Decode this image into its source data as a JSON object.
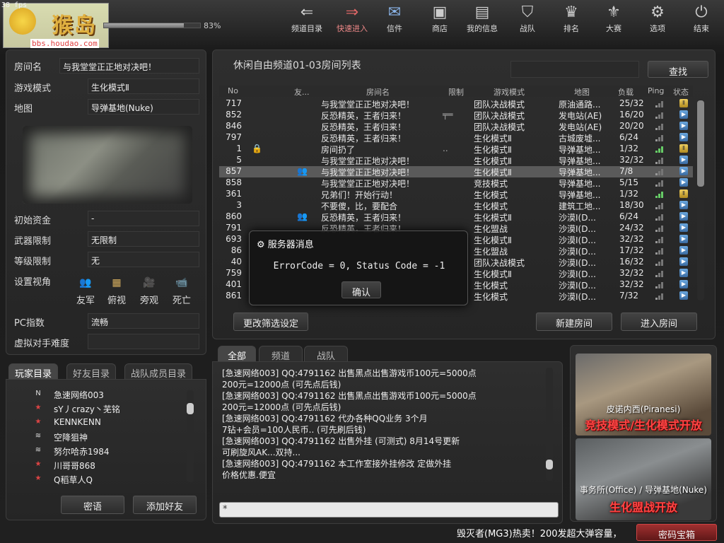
{
  "fps": "38 fps",
  "logo": {
    "text": "猴岛",
    "url": "bbs.houdao.com"
  },
  "progress": {
    "percent": 83,
    "text": "83%"
  },
  "nav": [
    {
      "label": "频道目录",
      "icon": "arrow-left-icon"
    },
    {
      "label": "快速进入",
      "icon": "double-arrow-right-icon"
    },
    {
      "label": "信件",
      "icon": "mail-icon"
    },
    {
      "label": "商店",
      "icon": "shop-icon"
    },
    {
      "label": "我的信息",
      "icon": "profile-card-icon"
    },
    {
      "label": "战队",
      "icon": "clan-shield-icon"
    },
    {
      "label": "排名",
      "icon": "trophy-icon"
    },
    {
      "label": "大赛",
      "icon": "medal-icon"
    },
    {
      "label": "选项",
      "icon": "gear-icon"
    },
    {
      "label": "结束",
      "icon": "power-icon"
    }
  ],
  "room_info": {
    "name_label": "房间名",
    "name_value": "与我堂堂正正地对决吧！",
    "mode_label": "游戏模式",
    "mode_value": "生化模式Ⅱ",
    "map_label": "地图",
    "map_value": "导弹基地(Nuke)",
    "money_label": "初始资金",
    "money_value": "-",
    "weapon_label": "武器限制",
    "weapon_value": "无限制",
    "level_label": "等级限制",
    "level_value": "无",
    "view_label": "设置视角",
    "view_options": [
      "友军",
      "俯视",
      "旁观",
      "死亡"
    ],
    "pc_label": "PC指数",
    "pc_value": "流畅",
    "ai_label": "虚拟对手难度",
    "ai_value": ""
  },
  "player_tabs": [
    "玩家目录",
    "好友目录",
    "战队成员目录"
  ],
  "players": [
    {
      "rank": "N",
      "name": "急速网络003"
    },
    {
      "rank": "★",
      "name": "sY丿crazy丶芜铭"
    },
    {
      "rank": "★",
      "name": "KENNKENN"
    },
    {
      "rank": "≋",
      "name": "空降狙神"
    },
    {
      "rank": "≋",
      "name": "努尔哈赤1984"
    },
    {
      "rank": "★",
      "name": "川哥哥868"
    },
    {
      "rank": "★",
      "name": "Q稻草人Q"
    }
  ],
  "player_buttons": {
    "whisper": "密语",
    "add_friend": "添加好友"
  },
  "room_list": {
    "title": "休闲自由频道01-03房间列表",
    "search_button": "查找",
    "headers": [
      "No",
      "友...",
      "房间名",
      "限制",
      "游戏模式",
      "地图",
      "负载",
      "Ping",
      "状态"
    ],
    "rows": [
      {
        "no": "717",
        "name": "与我堂堂正正地对决吧！",
        "limit": "",
        "mode": "团队决战模式",
        "map": "原油通路...",
        "load": "25/32",
        "ping": 1,
        "status": "wait"
      },
      {
        "no": "852",
        "name": "反恐精英，王者归来！",
        "limit": "gun",
        "mode": "团队决战模式",
        "map": "发电站(AE)",
        "load": "16/20",
        "ping": 1,
        "status": "play"
      },
      {
        "no": "846",
        "name": "反恐精英，王者归来！",
        "limit": "",
        "mode": "团队决战模式",
        "map": "发电站(AE)",
        "load": "20/20",
        "ping": 1,
        "status": "play"
      },
      {
        "no": "797",
        "name": "反恐精英，王者归来！",
        "limit": "",
        "mode": "生化模式Ⅱ",
        "map": "古城废墟...",
        "load": "6/24",
        "ping": 1,
        "status": "play"
      },
      {
        "no": "1",
        "name": "房间扔了",
        "limit": "..",
        "mode": "生化模式Ⅱ",
        "map": "导弹基地...",
        "load": "1/32",
        "ping": 3,
        "status": "wait",
        "lock": true
      },
      {
        "no": "5",
        "name": "与我堂堂正正地对决吧！",
        "limit": "",
        "mode": "生化模式Ⅱ",
        "map": "导弹基地...",
        "load": "32/32",
        "ping": 1,
        "status": "play"
      },
      {
        "no": "857",
        "name": "与我堂堂正正地对决吧！",
        "limit": "",
        "mode": "生化模式Ⅱ",
        "map": "导弹基地...",
        "load": "7/8",
        "ping": 1,
        "status": "play",
        "friend": true,
        "selected": true
      },
      {
        "no": "858",
        "name": "与我堂堂正正地对决吧！",
        "limit": "",
        "mode": "竞技模式",
        "map": "导弹基地...",
        "load": "5/15",
        "ping": 1,
        "status": "play"
      },
      {
        "no": "361",
        "name": "兄弟们！开始行动！",
        "limit": "",
        "mode": "生化模式",
        "map": "导弹基地...",
        "load": "1/32",
        "ping": 3,
        "status": "wait"
      },
      {
        "no": "3",
        "name": "不要傻，比，要配合",
        "limit": "",
        "mode": "生化模式",
        "map": "建筑工地...",
        "load": "18/30",
        "ping": 1,
        "status": "play"
      },
      {
        "no": "860",
        "name": "反恐精英，王者归来！",
        "limit": "",
        "mode": "生化模式Ⅱ",
        "map": "沙漠Ⅰ(D...",
        "load": "6/24",
        "ping": 1,
        "status": "play",
        "friend": true
      },
      {
        "no": "791",
        "name": "反恐精英，王者归来！",
        "limit": "",
        "mode": "生化盟战",
        "map": "沙漠Ⅰ(D...",
        "load": "24/32",
        "ping": 1,
        "status": "play"
      },
      {
        "no": "693",
        "name": "",
        "limit": "",
        "mode": "生化模式Ⅱ",
        "map": "沙漠Ⅰ(D...",
        "load": "32/32",
        "ping": 1,
        "status": "play"
      },
      {
        "no": "86",
        "name": "",
        "limit": "",
        "mode": "生化盟战",
        "map": "沙漠Ⅰ(D...",
        "load": "17/32",
        "ping": 1,
        "status": "play"
      },
      {
        "no": "40",
        "name": "",
        "limit": "",
        "mode": "团队决战模式",
        "map": "沙漠Ⅰ(D...",
        "load": "16/32",
        "ping": 1,
        "status": "play"
      },
      {
        "no": "759",
        "name": "",
        "limit": "",
        "mode": "生化模式Ⅱ",
        "map": "沙漠Ⅰ(D...",
        "load": "32/32",
        "ping": 1,
        "status": "play"
      },
      {
        "no": "401",
        "name": "",
        "limit": "",
        "mode": "生化模式",
        "map": "沙漠Ⅰ(D...",
        "load": "32/32",
        "ping": 1,
        "status": "play"
      },
      {
        "no": "861",
        "name": "",
        "limit": "",
        "mode": "生化模式",
        "map": "沙漠Ⅰ(D...",
        "load": "7/32",
        "ping": 1,
        "status": "play"
      }
    ],
    "buttons": {
      "filter": "更改筛选设定",
      "create": "新建房间",
      "enter": "进入房间"
    }
  },
  "dialog": {
    "title": "服务器消息",
    "message": "ErrorCode = 0, Status Code = -1",
    "ok": "确认"
  },
  "chat_tabs": [
    "全部",
    "频道",
    "战队"
  ],
  "chat_lines": [
    "[急速网络003] QQ:4791162  出售黑点出售游戏币100元=5000点",
    "200元=12000点 (可先点后钱)",
    "[急速网络003] QQ:4791162  出售黑点出售游戏币100元=5000点",
    "200元=12000点 (可先点后钱)",
    "[急速网络003] QQ:4791162  代办各种QQ业务 3个月",
    "7钻+会员=100人民币.. (可先刷后钱)",
    "[急速网络003] QQ:4791162  出售外挂 (可测式) 8月14号更新",
    "可刷旋风AK...双持...",
    "[急速网络003] QQ:4791162  本工作室接外挂修改 定做外挂",
    "价格优惠.便宜"
  ],
  "chat_input": "*",
  "promos": [
    {
      "caption": "皮诺内西(Piranesi)",
      "headline": "竞技模式/生化模式开放"
    },
    {
      "caption": "事务所(Office) / 导弹基地(Nuke)",
      "headline": "生化盟战开放"
    }
  ],
  "ticker": "毁灭者(MG3)热卖！200发超大弹容量，",
  "password_button": "密码宝箱"
}
